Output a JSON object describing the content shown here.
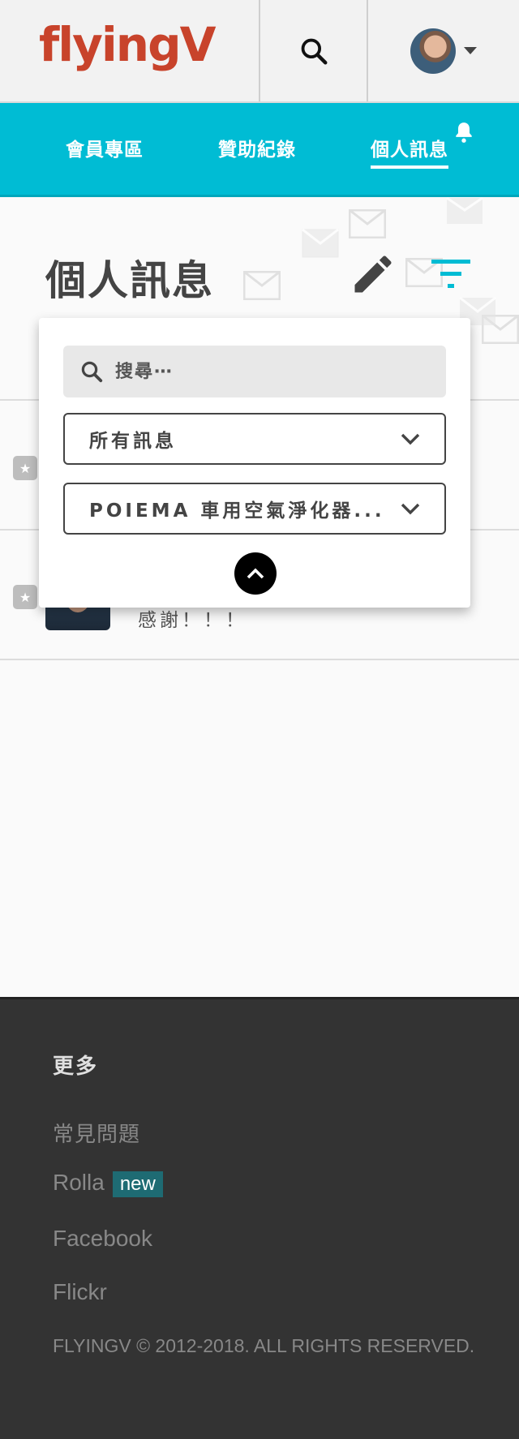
{
  "header": {
    "logo_text": "flyingV",
    "brand_color": "#c8432b"
  },
  "tabs": [
    {
      "label": "會員專區",
      "active": false
    },
    {
      "label": "贊助紀錄",
      "active": false
    },
    {
      "label": "個人訊息",
      "active": true
    }
  ],
  "accent_color": "#00bcd4",
  "page": {
    "title": "個人訊息"
  },
  "filter_panel": {
    "search_placeholder": "搜尋⋯",
    "message_filter": "所有訊息",
    "project_filter": "POIEMA 車用空氣淨化器..."
  },
  "messages": [
    {
      "preview": ""
    },
    {
      "preview": "感謝！！！"
    }
  ],
  "footer": {
    "heading": "更多",
    "links": [
      {
        "label": "常見問題"
      },
      {
        "label": "Rolla",
        "badge": "new"
      },
      {
        "label": "Facebook"
      },
      {
        "label": "Flickr"
      }
    ],
    "copyright": "FLYINGV © 2012-2018. ALL RIGHTS RESERVED."
  }
}
